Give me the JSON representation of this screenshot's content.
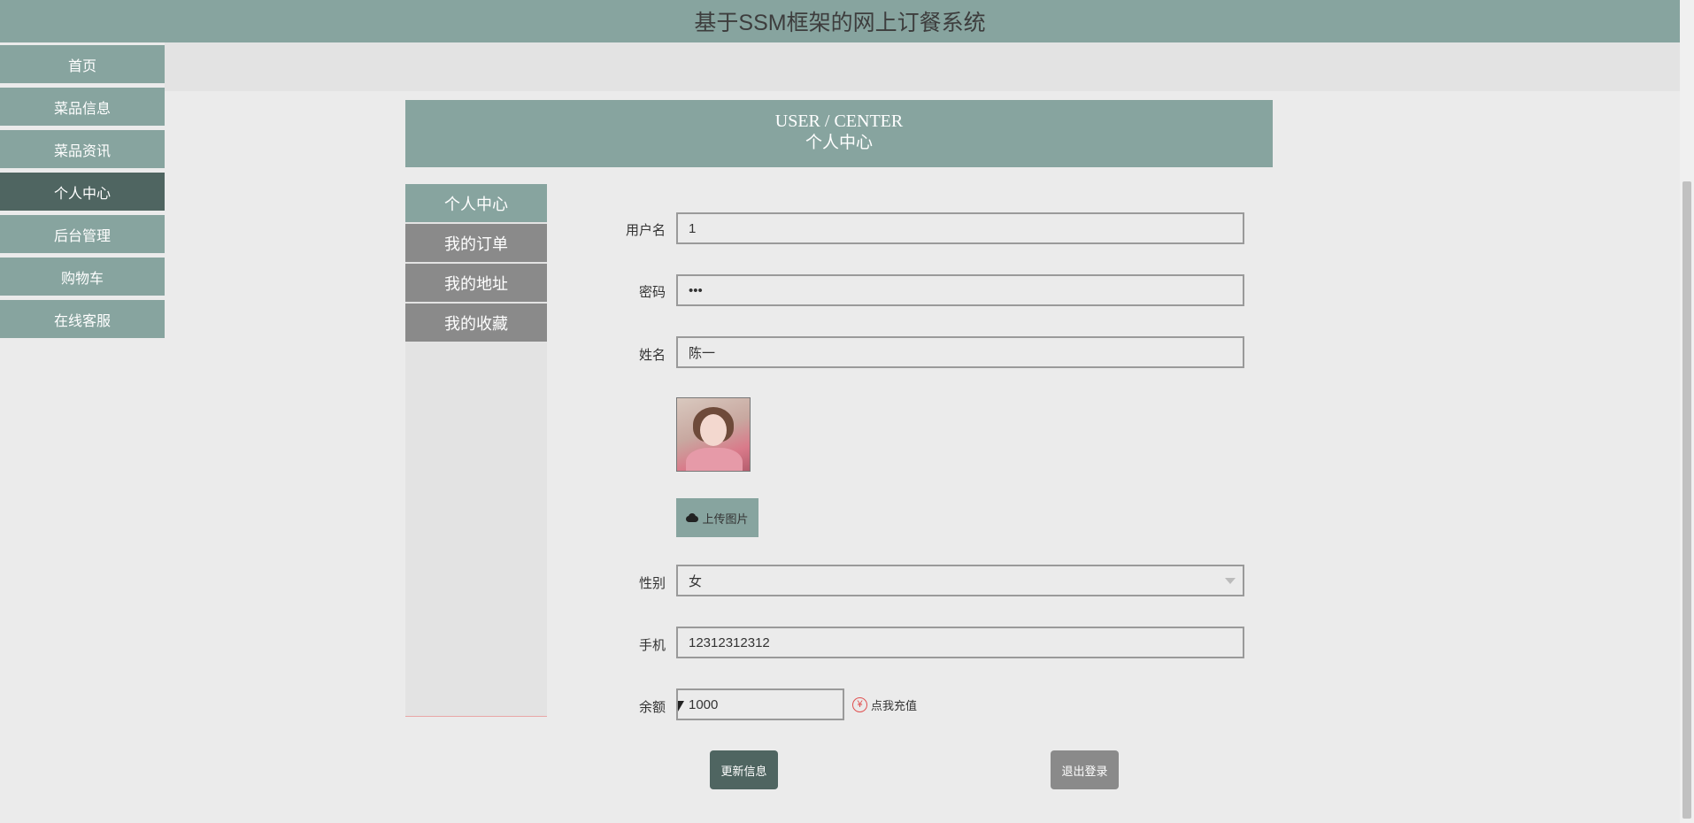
{
  "header": {
    "title": "基于SSM框架的网上订餐系统"
  },
  "sidebar": {
    "items": [
      {
        "label": "首页"
      },
      {
        "label": "菜品信息"
      },
      {
        "label": "菜品资讯"
      },
      {
        "label": "个人中心"
      },
      {
        "label": "后台管理"
      },
      {
        "label": "购物车"
      },
      {
        "label": "在线客服"
      }
    ],
    "active": "个人中心"
  },
  "banner": {
    "en": "USER / CENTER",
    "cn": "个人中心"
  },
  "subnav": {
    "items": [
      {
        "label": "个人中心"
      },
      {
        "label": "我的订单"
      },
      {
        "label": "我的地址"
      },
      {
        "label": "我的收藏"
      }
    ],
    "active": "个人中心"
  },
  "form": {
    "username": {
      "label": "用户名",
      "value": "1"
    },
    "password": {
      "label": "密码",
      "value": "•••"
    },
    "name": {
      "label": "姓名",
      "value": "陈一"
    },
    "upload_label": "上传图片",
    "gender": {
      "label": "性别",
      "value": "女"
    },
    "phone": {
      "label": "手机",
      "value": "12312312312"
    },
    "balance": {
      "label": "余额",
      "value": "1000"
    },
    "recharge_symbol": "¥",
    "recharge_label": "点我充值"
  },
  "buttons": {
    "update": "更新信息",
    "logout": "退出登录"
  },
  "colors": {
    "primary": "#87a49f",
    "active": "#4f6561",
    "neutral": "#8a8a8a"
  }
}
